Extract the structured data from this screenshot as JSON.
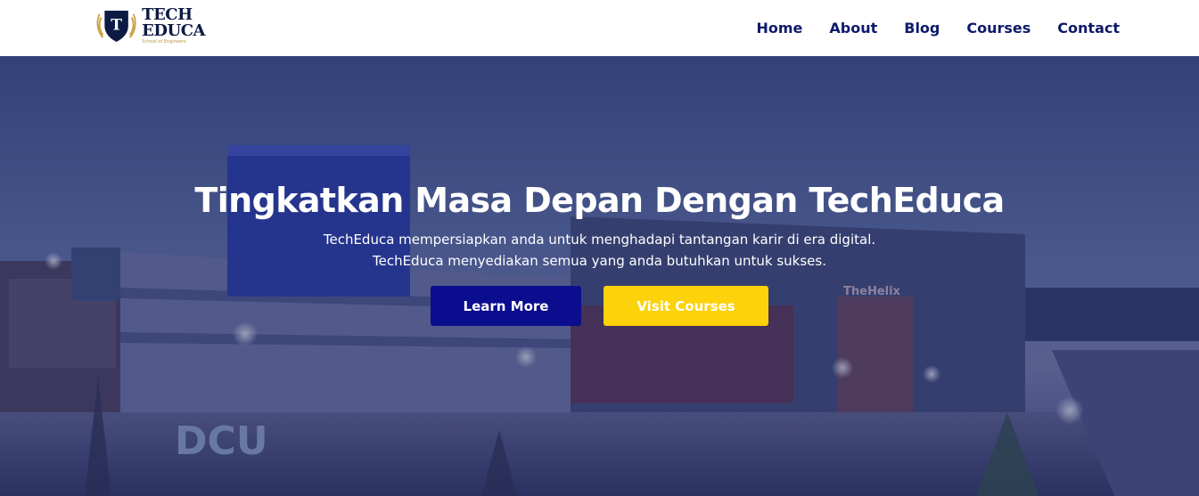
{
  "brand": {
    "line1": "TECH",
    "line2": "EDUCA",
    "tagline": "School of Engineers",
    "shield_letter": "T",
    "icon": "shield-laurel-icon"
  },
  "nav": {
    "items": [
      {
        "label": "Home"
      },
      {
        "label": "About"
      },
      {
        "label": "Blog"
      },
      {
        "label": "Courses"
      },
      {
        "label": "Contact"
      }
    ]
  },
  "hero": {
    "title": "Tingkatkan Masa Depan Dengan TechEduca",
    "subtitle_line1": "TechEduca mempersiapkan anda untuk menghadapi tantangan karir di era digital.",
    "subtitle_line2": "TechEduca menyediakan semua yang anda butuhkan untuk sukses.",
    "primary_button": "Learn More",
    "secondary_button": "Visit Courses",
    "building_sign": "TheHelix",
    "ground_letters": "DCU"
  },
  "colors": {
    "nav_text": "#0e1a6b",
    "primary_button": "#0b0d8f",
    "secondary_button": "#fcd20a",
    "overlay": "#141e5a"
  }
}
